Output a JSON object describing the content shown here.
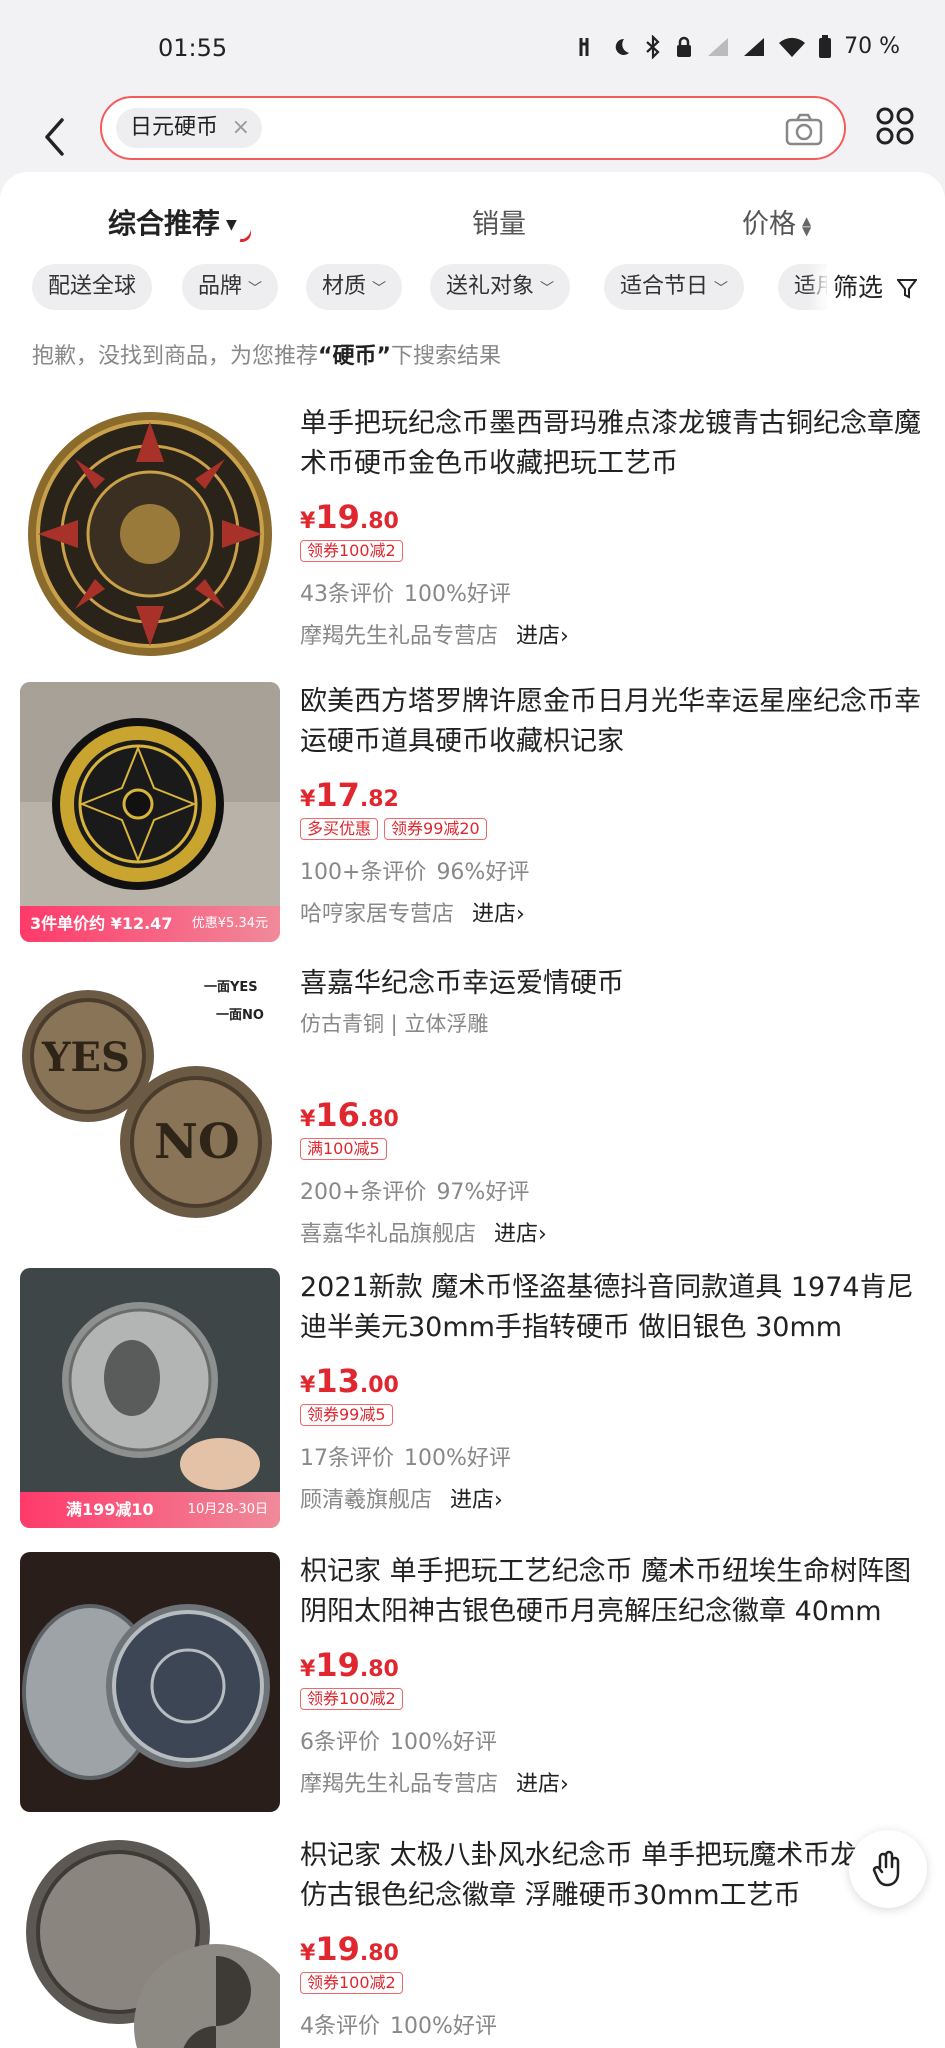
{
  "status": {
    "time": "01:55",
    "battery": "70 %"
  },
  "search": {
    "query": "日元硬币",
    "clear_glyph": "×"
  },
  "sort": {
    "main": "综合推荐",
    "sales": "销量",
    "price": "价格"
  },
  "filters": {
    "items": [
      "配送全球",
      "品牌",
      "材质",
      "送礼对象",
      "适合节日",
      "适用"
    ],
    "screen": "筛选"
  },
  "notice": {
    "prefix": "抱歉，没找到商品，为您推荐",
    "keyword": "“硬币”",
    "suffix": "下搜索结果"
  },
  "products": [
    {
      "title": "单手把玩纪念币墨西哥玛雅点漆龙镀青古铜纪念章魔术币硬币金色币收藏把玩工艺币",
      "price_sym": "¥",
      "price_int": "19",
      "price_dec": ".80",
      "tags": [
        "领券100减2"
      ],
      "reviews": "43条评价",
      "rating": "100%好评",
      "shop": "摩羯先生礼品专营店",
      "enter": "进店›"
    },
    {
      "title": "欧美西方塔罗牌许愿金币日月光华幸运星座纪念币幸运硬币道具硬币收藏枳记家",
      "price_sym": "¥",
      "price_int": "17",
      "price_dec": ".82",
      "tags": [
        "多买优惠",
        "领券99减20"
      ],
      "reviews": "100+条评价",
      "rating": "96%好评",
      "shop": "哈哼家居专营店",
      "enter": "进店›",
      "banner_left": "3件单价约 ¥12.47",
      "banner_right": "优惠¥5.34元"
    },
    {
      "title": "喜嘉华纪念币幸运爱情硬币",
      "subtitle": "仿古青铜 | 立体浮雕",
      "price_sym": "¥",
      "price_int": "16",
      "price_dec": ".80",
      "tags": [
        "满100减5"
      ],
      "reviews": "200+条评价",
      "rating": "97%好评",
      "shop": "喜嘉华礼品旗舰店",
      "enter": "进店›",
      "img_text_1": "一面YES",
      "img_text_2": "一面NO",
      "coin_1": "YES",
      "coin_2": "NO"
    },
    {
      "title": "2021新款 魔术币怪盗基德抖音同款道具 1974肯尼迪半美元30mm手指转硬币 做旧银色 30mm",
      "price_sym": "¥",
      "price_int": "13",
      "price_dec": ".00",
      "tags": [
        "领券99减5"
      ],
      "reviews": "17条评价",
      "rating": "100%好评",
      "shop": "顾清羲旗舰店",
      "enter": "进店›",
      "banner_left": "满199减10",
      "banner_right": "10月28-30日"
    },
    {
      "title": "枳记家 单手把玩工艺纪念币 魔术币纽埃生命树阵图阴阳太阳神古银色硬币月亮解压纪念徽章 40mm直...",
      "price_sym": "¥",
      "price_int": "19",
      "price_dec": ".80",
      "tags": [
        "领券100减2"
      ],
      "reviews": "6条评价",
      "rating": "100%好评",
      "shop": "摩羯先生礼品专营店",
      "enter": "进店›"
    },
    {
      "title": "枳记家 太极八卦风水纪念币 单手把玩魔术币龙凤舞仿古银色纪念徽章 浮雕硬币30mm工艺币",
      "price_sym": "¥",
      "price_int": "19",
      "price_dec": ".80",
      "tags": [
        "领券100减2"
      ],
      "reviews": "4条评价",
      "rating": "100%好评"
    }
  ],
  "colors": {
    "accent": "#e0262e",
    "search_border": "#f45b5b"
  }
}
